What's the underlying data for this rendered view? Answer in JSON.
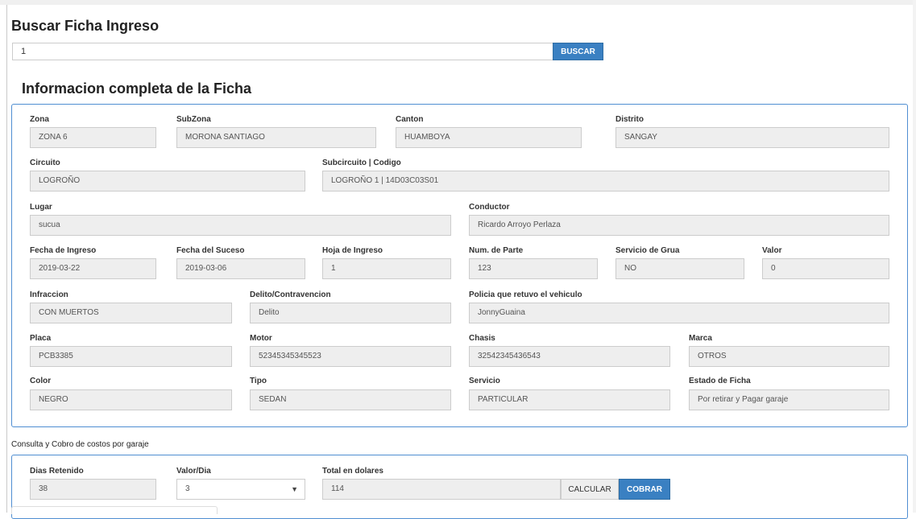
{
  "search": {
    "title": "Buscar Ficha Ingreso",
    "value": "1",
    "button_label": "BUSCAR"
  },
  "ficha": {
    "heading": "Informacion completa de la Ficha",
    "fields": [
      {
        "label": "Zona",
        "value": "ZONA 6"
      },
      {
        "label": "SubZona",
        "value": "MORONA SANTIAGO"
      },
      {
        "label": "Canton",
        "value": "HUAMBOYA"
      },
      {
        "label": "Distrito",
        "value": "SANGAY"
      },
      {
        "label": "Circuito",
        "value": "LOGROÑO"
      },
      {
        "label": "Subcircuito | Codigo",
        "value": "LOGROÑO 1  |  14D03C03S01"
      },
      {
        "label": "Lugar",
        "value": "sucua"
      },
      {
        "label": "Conductor",
        "value": "Ricardo Arroyo Perlaza"
      },
      {
        "label": "Fecha de Ingreso",
        "value": "2019-03-22"
      },
      {
        "label": "Fecha del Suceso",
        "value": "2019-03-06"
      },
      {
        "label": "Hoja de Ingreso",
        "value": "1"
      },
      {
        "label": "Num. de Parte",
        "value": "123"
      },
      {
        "label": "Servicio de Grua",
        "value": "NO"
      },
      {
        "label": "Valor",
        "value": "0"
      },
      {
        "label": "Infraccion",
        "value": "CON MUERTOS"
      },
      {
        "label": "Delito/Contravencion",
        "value": "Delito"
      },
      {
        "label": "Policia que retuvo el vehiculo",
        "value": "JonnyGuaina"
      },
      {
        "label": "Placa",
        "value": "PCB3385"
      },
      {
        "label": "Motor",
        "value": "52345345345523"
      },
      {
        "label": "Chasis",
        "value": "32542345436543"
      },
      {
        "label": "Marca",
        "value": "OTROS"
      },
      {
        "label": "Color",
        "value": "NEGRO"
      },
      {
        "label": "Tipo",
        "value": "SEDAN"
      },
      {
        "label": "Servicio",
        "value": "PARTICULAR"
      },
      {
        "label": "Estado de Ficha",
        "value": "Por retirar y Pagar garaje"
      }
    ]
  },
  "garaje": {
    "heading": "Consulta y Cobro de costos por garaje",
    "dias_label": "Dias Retenido",
    "dias_value": "38",
    "valor_dia_label": "Valor/Dia",
    "valor_dia_value": "3",
    "total_label": "Total en dolares",
    "total_value": "114",
    "calcular_label": "CALCULAR",
    "cobrar_label": "COBRAR"
  },
  "colors": {
    "primary": "#3a80c2",
    "panel_border": "#4f8ed2",
    "field_bg": "#eeeeee"
  }
}
